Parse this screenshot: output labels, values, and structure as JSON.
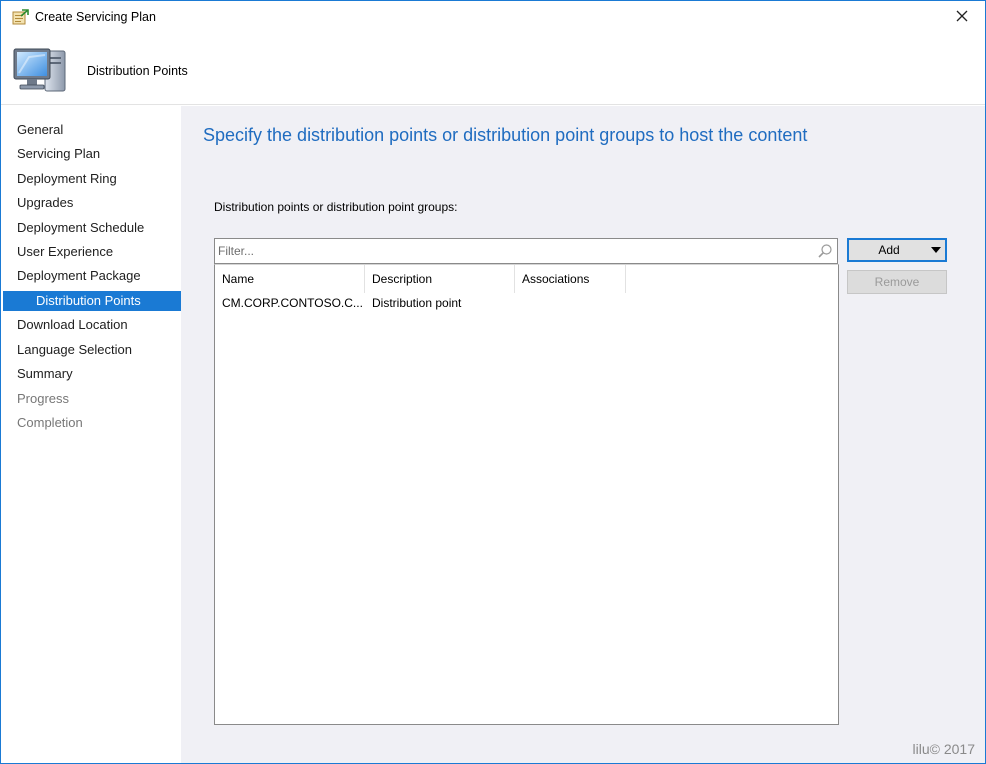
{
  "window": {
    "title": "Create Servicing Plan",
    "close_glyph": "✕",
    "icon": "wizard-plan-icon"
  },
  "header": {
    "title": "Distribution Points",
    "icon": "computer-monitor-icon"
  },
  "nav": {
    "items": [
      {
        "label": "General",
        "state": "normal"
      },
      {
        "label": "Servicing Plan",
        "state": "normal"
      },
      {
        "label": "Deployment Ring",
        "state": "normal"
      },
      {
        "label": "Upgrades",
        "state": "normal"
      },
      {
        "label": "Deployment Schedule",
        "state": "normal"
      },
      {
        "label": "User Experience",
        "state": "normal"
      },
      {
        "label": "Deployment Package",
        "state": "normal"
      },
      {
        "label": "Distribution Points",
        "state": "selected"
      },
      {
        "label": "Download Location",
        "state": "normal"
      },
      {
        "label": "Language Selection",
        "state": "normal"
      },
      {
        "label": "Summary",
        "state": "normal"
      },
      {
        "label": "Progress",
        "state": "disabled"
      },
      {
        "label": "Completion",
        "state": "disabled"
      }
    ]
  },
  "main": {
    "heading": "Specify the distribution points or distribution point groups to host the content",
    "list_caption": "Distribution points or distribution point groups:",
    "filter": {
      "placeholder": "Filter...",
      "value": "",
      "icon": "search-icon"
    },
    "columns": [
      "Name",
      "Description",
      "Associations"
    ],
    "rows": [
      {
        "name": "CM.CORP.CONTOSO.C...",
        "description": "Distribution point",
        "associations": ""
      }
    ],
    "add_label": "Add",
    "remove_label": "Remove",
    "remove_enabled": false
  },
  "watermark": "lilu© 2017",
  "colors": {
    "accent": "#1a7ad4",
    "heading": "#1f6cc0",
    "content_bg": "#f0f0f5"
  }
}
